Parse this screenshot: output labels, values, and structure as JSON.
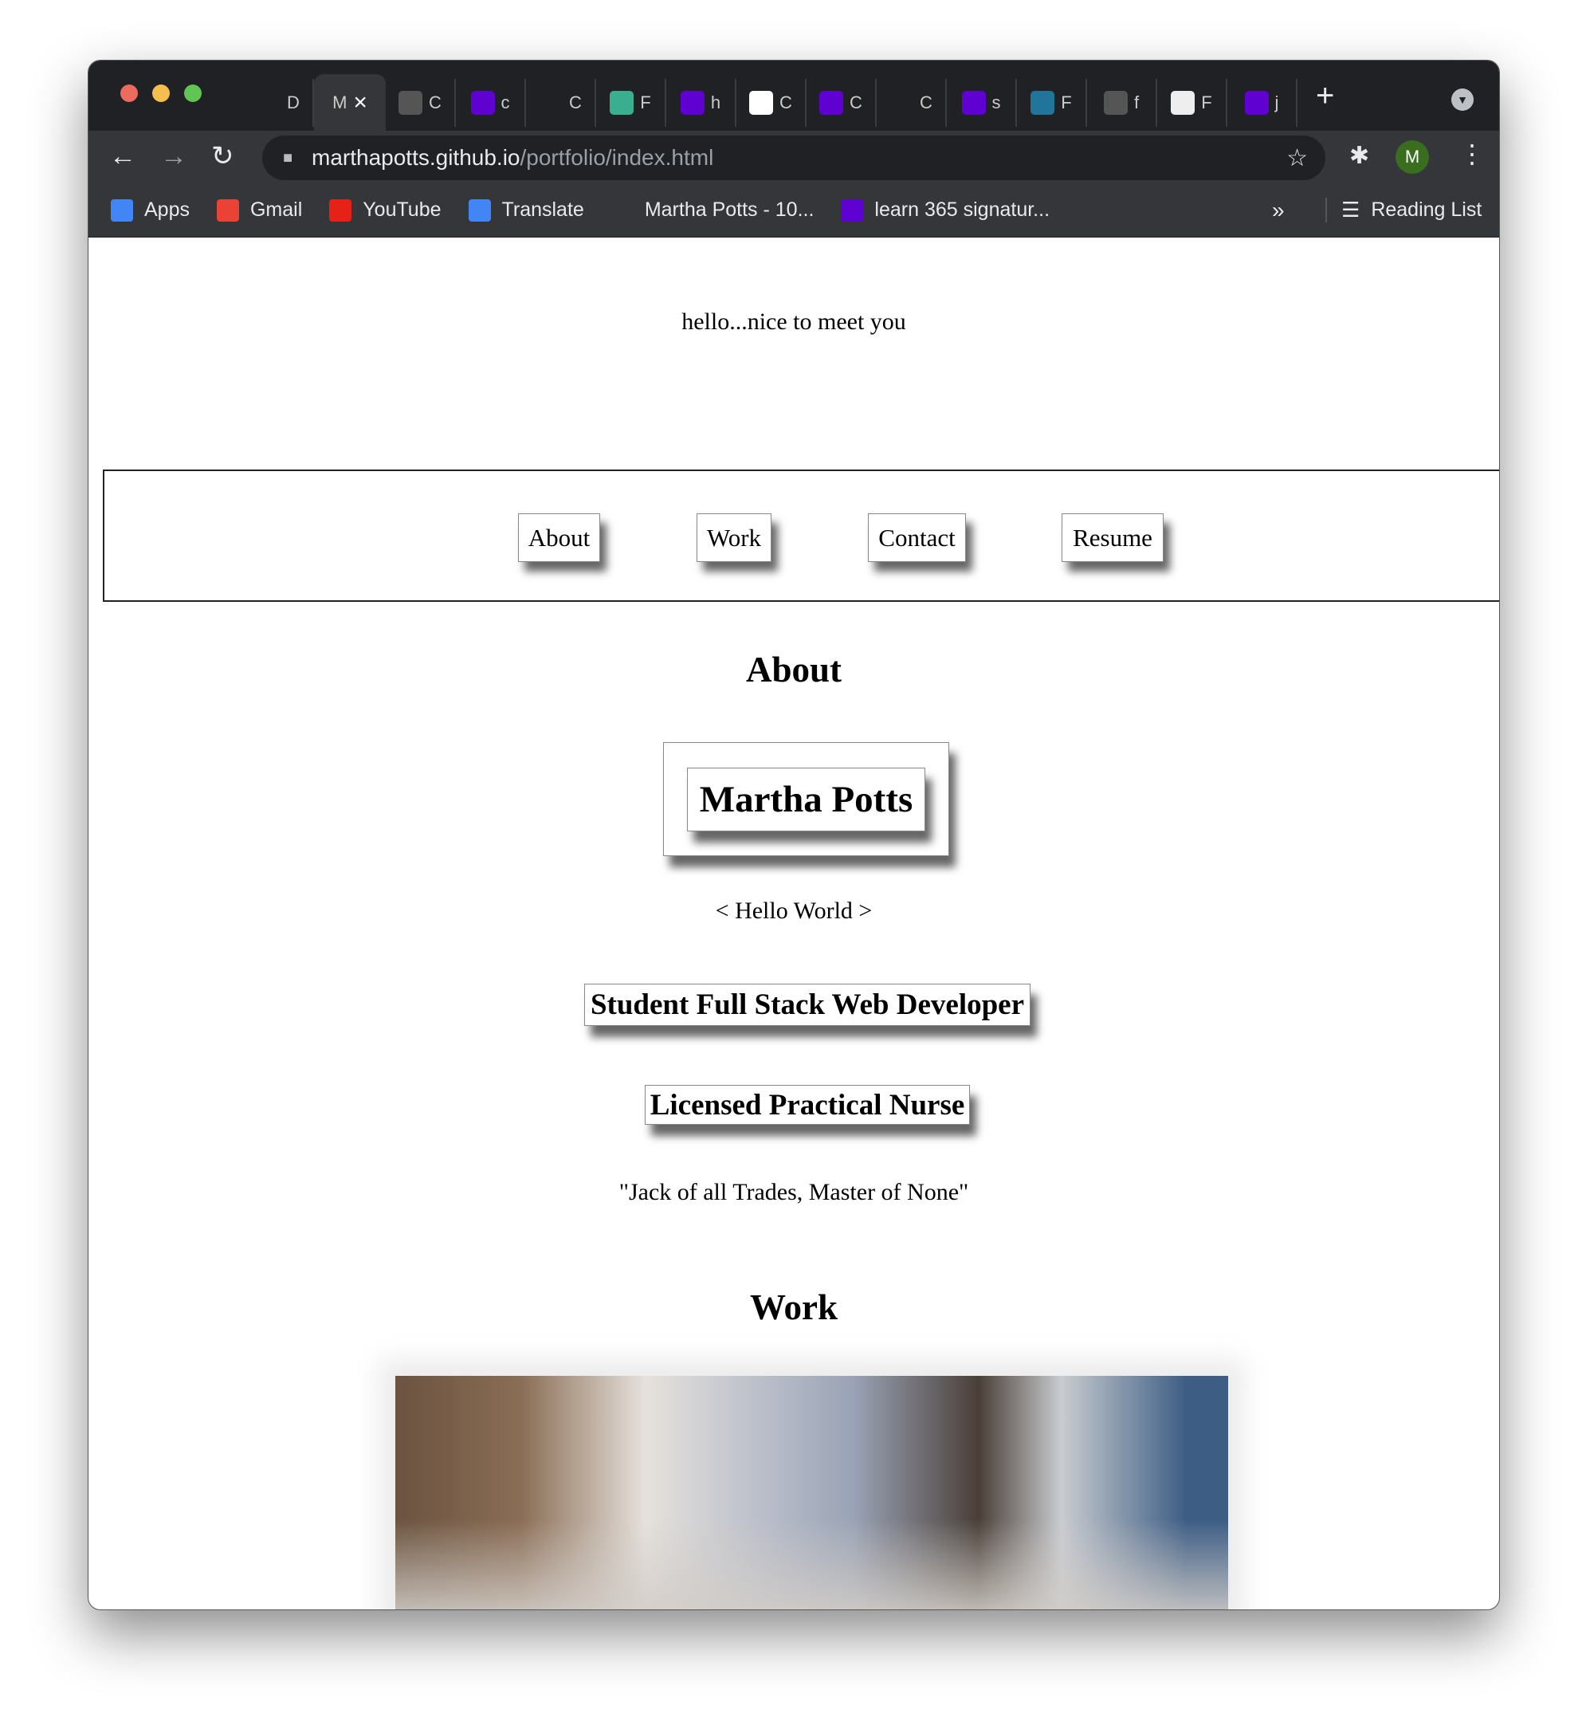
{
  "browser": {
    "tabs": [
      {
        "icon": "github-icon",
        "letter": "D",
        "bg": "#202124"
      },
      {
        "icon": "portfolio-tab",
        "letter": "M",
        "bg": "#35363a",
        "active": true
      },
      {
        "icon": "globe-icon",
        "letter": "C",
        "bg": "#555"
      },
      {
        "icon": "yahoo-icon",
        "letter": "c",
        "bg": "#5f01d1"
      },
      {
        "icon": "react-icon",
        "letter": "C",
        "bg": "#202124"
      },
      {
        "icon": "hex-icon",
        "letter": "F",
        "bg": "#3aaf8f"
      },
      {
        "icon": "yahoo-icon",
        "letter": "h",
        "bg": "#5f01d1"
      },
      {
        "icon": "w3schools-icon",
        "letter": "C",
        "bg": "#fff"
      },
      {
        "icon": "yahoo-icon",
        "letter": "C",
        "bg": "#5f01d1"
      },
      {
        "icon": "opera-icon",
        "letter": "C",
        "bg": "#202124"
      },
      {
        "icon": "yahoo-icon",
        "letter": "s",
        "bg": "#5f01d1"
      },
      {
        "icon": "wordpress-icon",
        "letter": "F",
        "bg": "#21759b"
      },
      {
        "icon": "globe-icon",
        "letter": "f",
        "bg": "#555"
      },
      {
        "icon": "globe-icon",
        "letter": "F",
        "bg": "#eee"
      },
      {
        "icon": "yahoo-icon",
        "letter": "j",
        "bg": "#5f01d1"
      }
    ],
    "active_tab_close": "×",
    "new_tab": "+",
    "url_host": "marthapotts.github.io",
    "url_path": "/portfolio/index.html",
    "profile_initial": "M",
    "bookmarks": [
      {
        "label": "Apps",
        "icon": "apps-grid-icon"
      },
      {
        "label": "Gmail",
        "icon": "gmail-icon"
      },
      {
        "label": "YouTube",
        "icon": "youtube-icon"
      },
      {
        "label": "Translate",
        "icon": "google-translate-icon"
      },
      {
        "label": "Martha Potts - 10...",
        "icon": "udacity-icon"
      },
      {
        "label": "learn 365 signatur...",
        "icon": "yahoo-icon"
      }
    ],
    "more_bookmarks": "»",
    "reading_list": "Reading List"
  },
  "page": {
    "greeting": "hello...nice to meet you",
    "nav": [
      "About",
      "Work",
      "Contact",
      "Resume"
    ],
    "about_heading": "About",
    "name": "Martha Potts",
    "hello_world": "< Hello World >",
    "title1": "Student Full Stack Web Developer",
    "title2": "Licensed Practical Nurse",
    "quote": "\"Jack of all Trades, Master of None\"",
    "work_heading": "Work"
  }
}
